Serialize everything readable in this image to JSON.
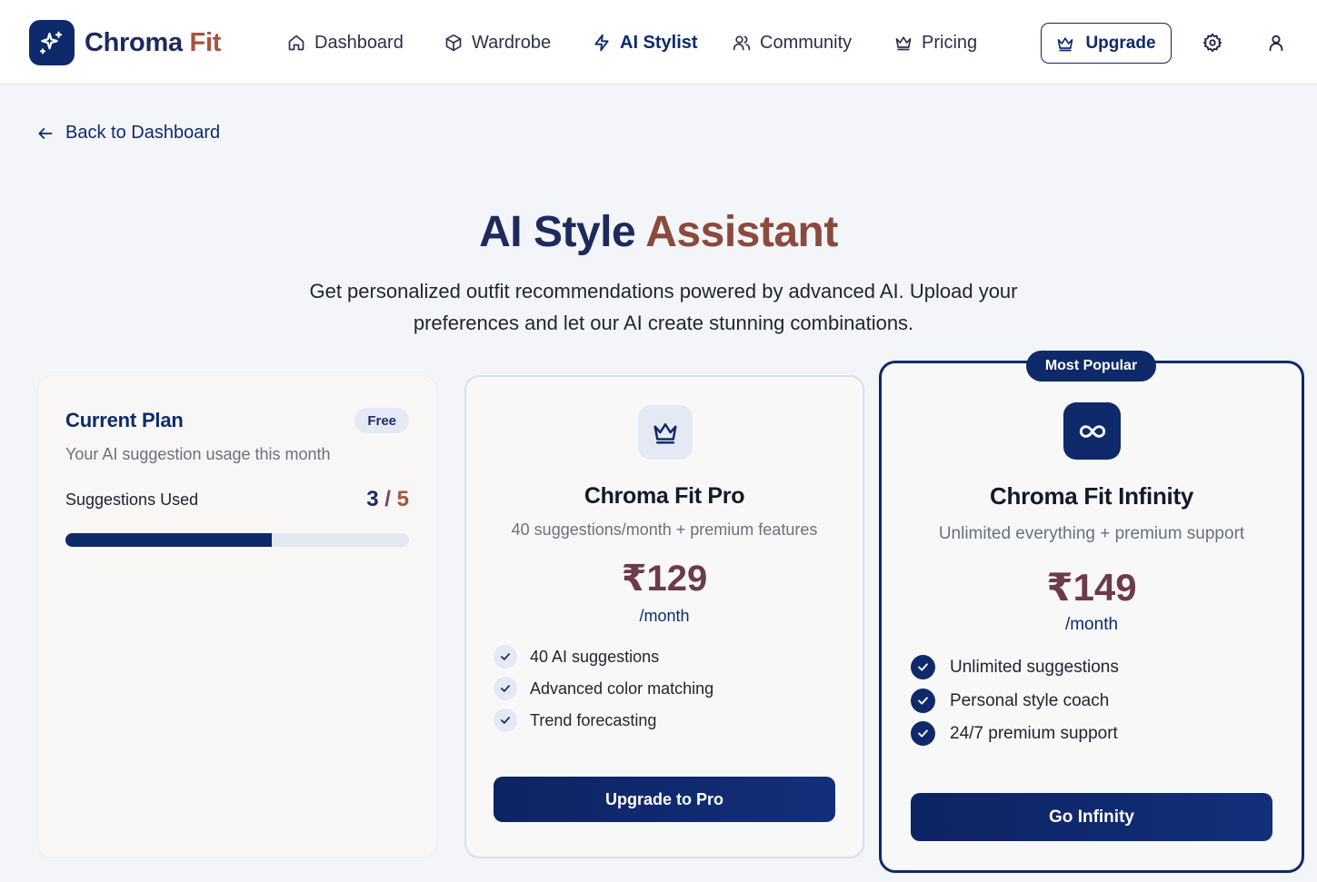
{
  "brand": {
    "name_part1": "Chroma",
    "name_part2": "Fit",
    "logo_icon": "sparkles-icon"
  },
  "nav": {
    "items": [
      {
        "label": "Dashboard",
        "icon": "home-icon"
      },
      {
        "label": "Wardrobe",
        "icon": "box-icon"
      },
      {
        "label": "AI Stylist",
        "icon": "lightning-icon",
        "active": true
      },
      {
        "label": "Community",
        "icon": "users-icon"
      },
      {
        "label": "Pricing",
        "icon": "crown-icon"
      }
    ],
    "upgrade_label": "Upgrade"
  },
  "back_link": "Back to Dashboard",
  "hero": {
    "title_part1": "AI Style",
    "title_part2": "Assistant",
    "subtitle": "Get personalized outfit recommendations powered by advanced AI. Upload your preferences and let our AI create stunning combinations."
  },
  "current_plan": {
    "title": "Current Plan",
    "badge": "Free",
    "subtitle": "Your AI suggestion usage this month",
    "usage_label": "Suggestions Used",
    "used": "3",
    "separator": "/",
    "limit": "5",
    "usage_fraction": 0.6
  },
  "pro_plan": {
    "name": "Chroma Fit Pro",
    "description": "40 suggestions/month + premium features",
    "price": "₹129",
    "period": "/month",
    "features": [
      "40 AI suggestions",
      "Advanced color matching",
      "Trend forecasting"
    ],
    "cta": "Upgrade to Pro"
  },
  "infinity_plan": {
    "badge": "Most Popular",
    "name": "Chroma Fit Infinity",
    "description": "Unlimited everything + premium support",
    "price": "₹149",
    "period": "/month",
    "features": [
      "Unlimited suggestions",
      "Personal style coach",
      "24/7 premium support"
    ],
    "cta": "Go Infinity"
  },
  "colors": {
    "primary": "#0e2a6b",
    "accent": "#a8533d",
    "price": "#6b3b4b",
    "background": "#f4f5f9"
  }
}
